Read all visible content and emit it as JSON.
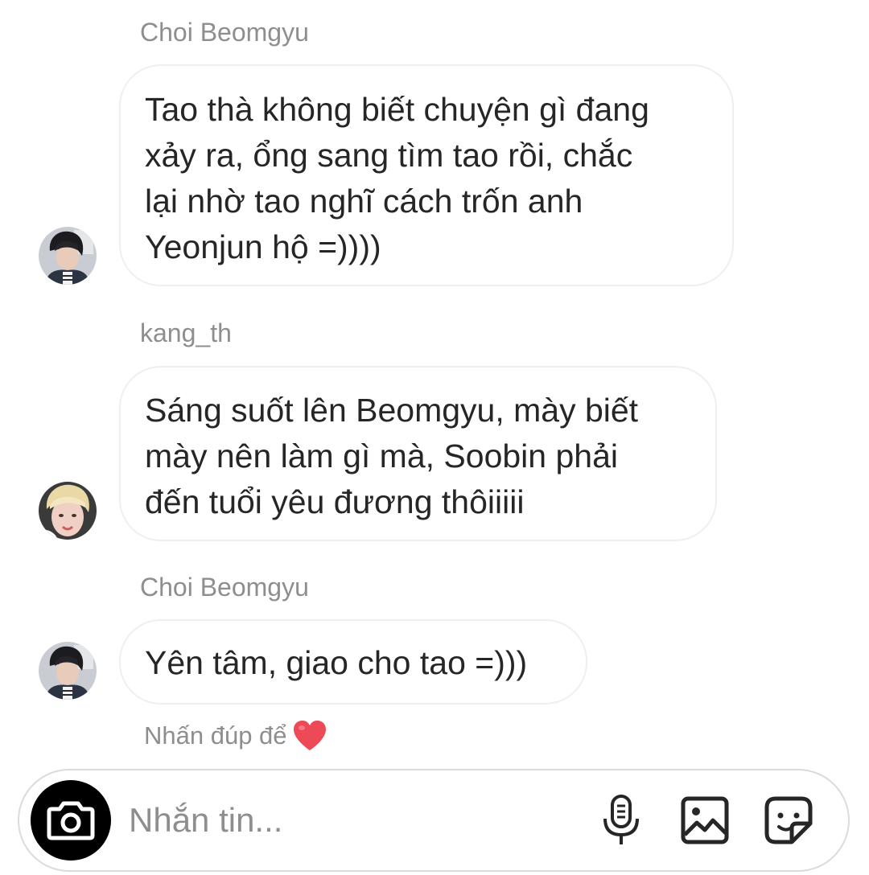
{
  "messages": [
    {
      "sender": "Choi Beomgyu",
      "lines": [
        "Tao thà không biết chuyện gì đang",
        "xảy ra, ổng sang tìm tao rồi, chắc",
        "lại nhờ tao nghĩ cách trốn anh",
        "Yeonjun hộ =))))"
      ],
      "avatar": "avatar-beomgyu"
    },
    {
      "sender": "kang_th",
      "lines": [
        "Sáng suốt lên Beomgyu, mày biết",
        "mày nên làm gì mà, Soobin phải",
        "đến tuổi yêu đương thôiiiii"
      ],
      "avatar": "avatar-kang-th"
    },
    {
      "sender": "Choi Beomgyu",
      "lines": [
        "Yên tâm, giao cho tao =)))"
      ],
      "avatar": "avatar-beomgyu"
    }
  ],
  "hint": {
    "text": "Nhấn đúp để",
    "icon": "heart-icon",
    "icon_color": "#ed4956"
  },
  "composer": {
    "placeholder": "Nhắn tin...",
    "value": "",
    "icons": [
      "camera-icon",
      "microphone-icon",
      "gallery-icon",
      "sticker-icon"
    ]
  },
  "colors": {
    "secondary_text": "#8e8e8e",
    "bubble_border": "#efefef",
    "camera_button": "#000000"
  }
}
